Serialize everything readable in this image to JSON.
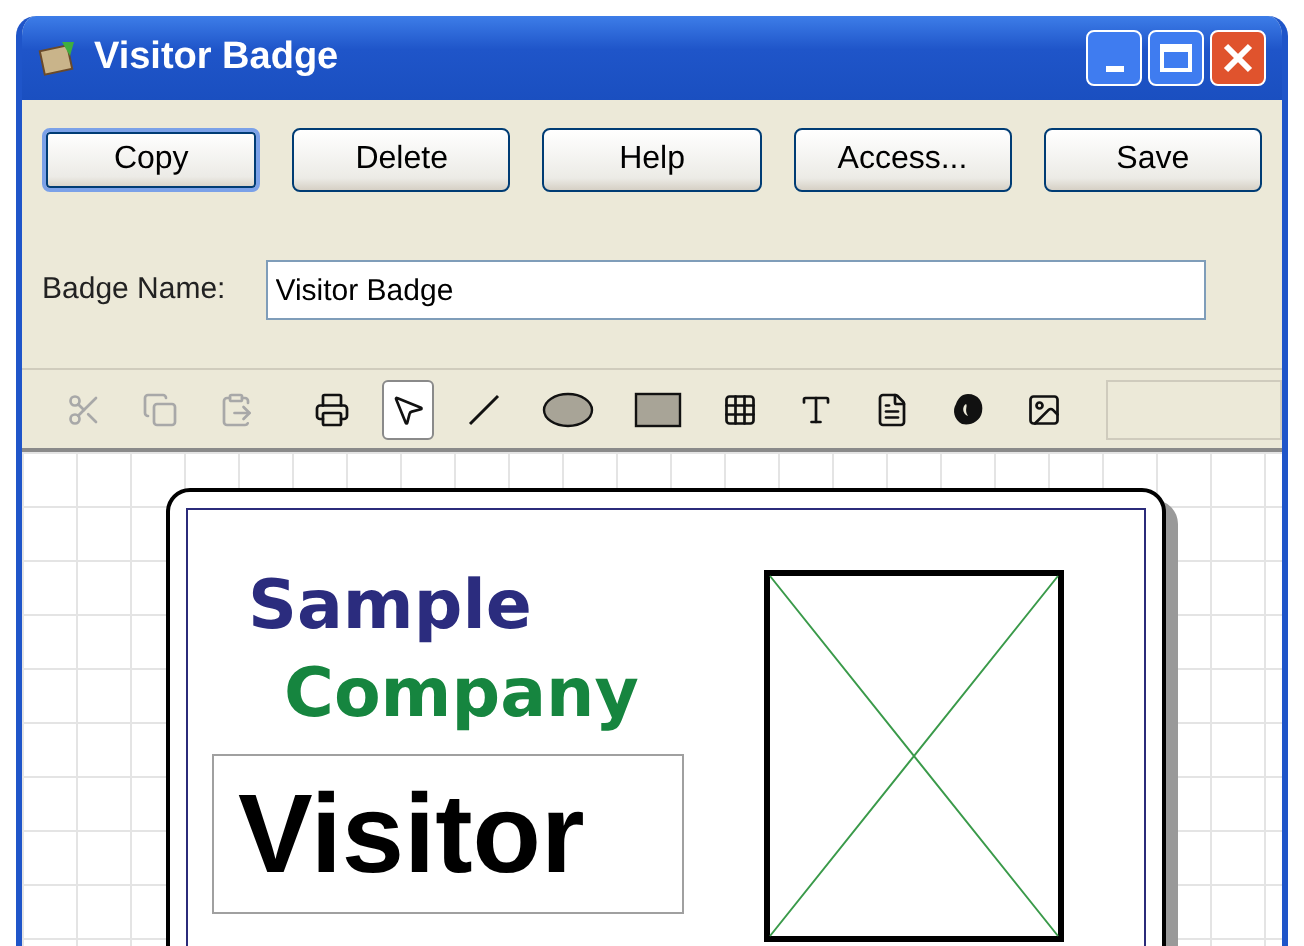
{
  "window": {
    "title": "Visitor Badge"
  },
  "buttons": [
    {
      "label": "Copy",
      "selected": true
    },
    {
      "label": "Delete",
      "selected": false
    },
    {
      "label": "Help",
      "selected": false
    },
    {
      "label": "Access...",
      "selected": false
    },
    {
      "label": "Save",
      "selected": false
    }
  ],
  "badge_name": {
    "label": "Badge Name:",
    "value": "Visitor Badge"
  },
  "toolbar": [
    {
      "kind": "cut",
      "disabled": true,
      "selected": false
    },
    {
      "kind": "copy",
      "disabled": true,
      "selected": false
    },
    {
      "kind": "paste",
      "disabled": true,
      "selected": false
    },
    {
      "kind": "print",
      "disabled": false,
      "selected": false
    },
    {
      "kind": "pointer",
      "disabled": false,
      "selected": true
    },
    {
      "kind": "line",
      "disabled": false,
      "selected": false
    },
    {
      "kind": "ellipse",
      "disabled": false,
      "selected": false
    },
    {
      "kind": "rectangle",
      "disabled": false,
      "selected": false
    },
    {
      "kind": "pattern",
      "disabled": false,
      "selected": false
    },
    {
      "kind": "text",
      "disabled": false,
      "selected": false
    },
    {
      "kind": "document",
      "disabled": false,
      "selected": false
    },
    {
      "kind": "blob",
      "disabled": false,
      "selected": false
    },
    {
      "kind": "image",
      "disabled": false,
      "selected": false
    }
  ],
  "badge": {
    "company_line_1": "Sample",
    "company_line_2": "Company",
    "visitor_label": "Visitor"
  }
}
